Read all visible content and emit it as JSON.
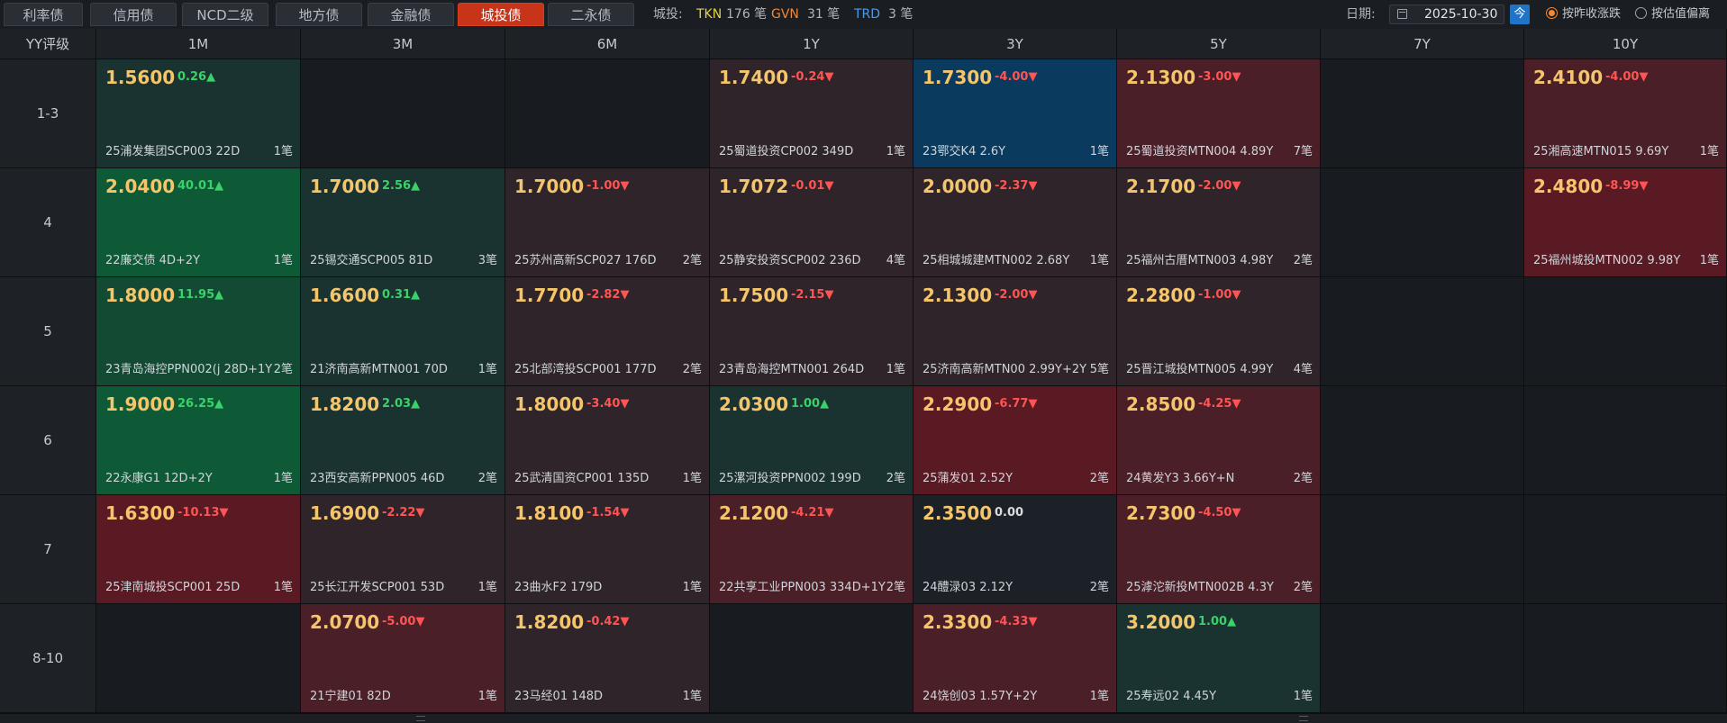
{
  "tabs": [
    "利率债",
    "信用债",
    "NCD二级",
    "地方债",
    "金融债",
    "城投债",
    "二永债"
  ],
  "active_tab": "城投债",
  "summary": {
    "label": "城投:",
    "tkn_label": "TKN",
    "tkn_count": "176 笔",
    "gvn_label": "GVN",
    "gvn_count": "31 笔",
    "trd_label": "TRD",
    "trd_count": "3 笔"
  },
  "date": {
    "label": "日期:",
    "value": "2025-10-30",
    "today": "今"
  },
  "radios": [
    {
      "label": "按昨收涨跌",
      "checked": true
    },
    {
      "label": "按估值偏离",
      "checked": false
    }
  ],
  "colors": {
    "up_strong": "#0e5a36",
    "up_mid": "#124a33",
    "up_weak": "#1a3330",
    "down_strong": "#5a1a24",
    "down_mid": "#4a1f27",
    "down_weak": "#2e2429",
    "blue": "#0a3a5e",
    "neutral": "#1c2128",
    "empty": "#181c21",
    "yield_text": "#f5c56b",
    "up_text": "#38d16a",
    "down_text": "#ff5454"
  },
  "grid": {
    "corner": "YY评级",
    "columns": [
      "1M",
      "3M",
      "6M",
      "1Y",
      "3Y",
      "5Y",
      "7Y",
      "10Y"
    ],
    "rows": [
      {
        "label": "1-3",
        "cells": [
          {
            "yld": "1.5600",
            "chg": "0.26▲",
            "dir": "up",
            "name": "25浦发集团SCP003 22D",
            "cnt": "1笔",
            "tone": "up_weak"
          },
          null,
          null,
          {
            "yld": "1.7400",
            "chg": "-0.24▼",
            "dir": "dn",
            "name": "25蜀道投资CP002 349D",
            "cnt": "1笔",
            "tone": "down_weak"
          },
          {
            "yld": "1.7300",
            "chg": "-4.00▼",
            "dir": "dn",
            "name": "23鄂交K4 2.6Y",
            "cnt": "1笔",
            "tone": "blue"
          },
          {
            "yld": "2.1300",
            "chg": "-3.00▼",
            "dir": "dn",
            "name": "25蜀道投资MTN004 4.89Y",
            "cnt": "7笔",
            "tone": "down_mid"
          },
          null,
          {
            "yld": "2.4100",
            "chg": "-4.00▼",
            "dir": "dn",
            "name": "25湘高速MTN015 9.69Y",
            "cnt": "1笔",
            "tone": "down_mid"
          }
        ]
      },
      {
        "label": "4",
        "cells": [
          {
            "yld": "2.0400",
            "chg": "40.01▲",
            "dir": "up",
            "name": "22廉交债 4D+2Y",
            "cnt": "1笔",
            "tone": "up_strong"
          },
          {
            "yld": "1.7000",
            "chg": "2.56▲",
            "dir": "up",
            "name": "25锡交通SCP005 81D",
            "cnt": "3笔",
            "tone": "up_weak"
          },
          {
            "yld": "1.7000",
            "chg": "-1.00▼",
            "dir": "dn",
            "name": "25苏州高新SCP027 176D",
            "cnt": "2笔",
            "tone": "down_weak"
          },
          {
            "yld": "1.7072",
            "chg": "-0.01▼",
            "dir": "dn",
            "name": "25静安投资SCP002 236D",
            "cnt": "4笔",
            "tone": "down_weak"
          },
          {
            "yld": "2.0000",
            "chg": "-2.37▼",
            "dir": "dn",
            "name": "25相城城建MTN002 2.68Y",
            "cnt": "1笔",
            "tone": "down_weak"
          },
          {
            "yld": "2.1700",
            "chg": "-2.00▼",
            "dir": "dn",
            "name": "25福州古厝MTN003 4.98Y",
            "cnt": "2笔",
            "tone": "down_weak"
          },
          null,
          {
            "yld": "2.4800",
            "chg": "-8.99▼",
            "dir": "dn",
            "name": "25福州城投MTN002 9.98Y",
            "cnt": "1笔",
            "tone": "down_strong"
          }
        ]
      },
      {
        "label": "5",
        "cells": [
          {
            "yld": "1.8000",
            "chg": "11.95▲",
            "dir": "up",
            "name": "23青岛海控PPN002(j 28D+1Y",
            "cnt": "2笔",
            "tone": "up_mid"
          },
          {
            "yld": "1.6600",
            "chg": "0.31▲",
            "dir": "up",
            "name": "21济南高新MTN001 70D",
            "cnt": "1笔",
            "tone": "up_weak"
          },
          {
            "yld": "1.7700",
            "chg": "-2.82▼",
            "dir": "dn",
            "name": "25北部湾投SCP001 177D",
            "cnt": "2笔",
            "tone": "down_weak"
          },
          {
            "yld": "1.7500",
            "chg": "-2.15▼",
            "dir": "dn",
            "name": "23青岛海控MTN001 264D",
            "cnt": "1笔",
            "tone": "down_weak"
          },
          {
            "yld": "2.1300",
            "chg": "-2.00▼",
            "dir": "dn",
            "name": "25济南高新MTN00 2.99Y+2Y",
            "cnt": "5笔",
            "tone": "down_weak"
          },
          {
            "yld": "2.2800",
            "chg": "-1.00▼",
            "dir": "dn",
            "name": "25晋江城投MTN005 4.99Y",
            "cnt": "4笔",
            "tone": "down_weak"
          },
          null,
          null
        ]
      },
      {
        "label": "6",
        "cells": [
          {
            "yld": "1.9000",
            "chg": "26.25▲",
            "dir": "up",
            "name": "22永康G1 12D+2Y",
            "cnt": "1笔",
            "tone": "up_strong"
          },
          {
            "yld": "1.8200",
            "chg": "2.03▲",
            "dir": "up",
            "name": "23西安高新PPN005 46D",
            "cnt": "2笔",
            "tone": "up_weak"
          },
          {
            "yld": "1.8000",
            "chg": "-3.40▼",
            "dir": "dn",
            "name": "25武清国资CP001 135D",
            "cnt": "1笔",
            "tone": "down_weak"
          },
          {
            "yld": "2.0300",
            "chg": "1.00▲",
            "dir": "up",
            "name": "25漯河投资PPN002 199D",
            "cnt": "2笔",
            "tone": "up_weak"
          },
          {
            "yld": "2.2900",
            "chg": "-6.77▼",
            "dir": "dn",
            "name": "25蒲发01 2.52Y",
            "cnt": "2笔",
            "tone": "down_strong"
          },
          {
            "yld": "2.8500",
            "chg": "-4.25▼",
            "dir": "dn",
            "name": "24黄发Y3 3.66Y+N",
            "cnt": "2笔",
            "tone": "down_mid"
          },
          null,
          null
        ]
      },
      {
        "label": "7",
        "cells": [
          {
            "yld": "1.6300",
            "chg": "-10.13▼",
            "dir": "dn",
            "name": "25津南城投SCP001 25D",
            "cnt": "1笔",
            "tone": "down_strong"
          },
          {
            "yld": "1.6900",
            "chg": "-2.22▼",
            "dir": "dn",
            "name": "25长江开发SCP001 53D",
            "cnt": "1笔",
            "tone": "down_weak"
          },
          {
            "yld": "1.8100",
            "chg": "-1.54▼",
            "dir": "dn",
            "name": "23曲水F2 179D",
            "cnt": "1笔",
            "tone": "down_weak"
          },
          {
            "yld": "2.1200",
            "chg": "-4.21▼",
            "dir": "dn",
            "name": "22共享工业PPN003 334D+1Y",
            "cnt": "2笔",
            "tone": "down_mid"
          },
          {
            "yld": "2.3500",
            "chg": "0.00",
            "dir": "flat",
            "name": "24醴渌03 2.12Y",
            "cnt": "2笔",
            "tone": "neutral"
          },
          {
            "yld": "2.7300",
            "chg": "-4.50▼",
            "dir": "dn",
            "name": "25滹沱新投MTN002B 4.3Y",
            "cnt": "2笔",
            "tone": "down_mid"
          },
          null,
          null
        ]
      },
      {
        "label": "8-10",
        "cells": [
          null,
          {
            "yld": "2.0700",
            "chg": "-5.00▼",
            "dir": "dn",
            "name": "21宁建01 82D",
            "cnt": "1笔",
            "tone": "down_mid"
          },
          {
            "yld": "1.8200",
            "chg": "-0.42▼",
            "dir": "dn",
            "name": "23马经01 148D",
            "cnt": "1笔",
            "tone": "down_weak"
          },
          null,
          {
            "yld": "2.3300",
            "chg": "-4.33▼",
            "dir": "dn",
            "name": "24饶创03 1.57Y+2Y",
            "cnt": "1笔",
            "tone": "down_mid"
          },
          {
            "yld": "3.2000",
            "chg": "1.00▲",
            "dir": "up",
            "name": "25寿远02 4.45Y",
            "cnt": "1笔",
            "tone": "up_weak"
          },
          null,
          null
        ]
      }
    ]
  }
}
